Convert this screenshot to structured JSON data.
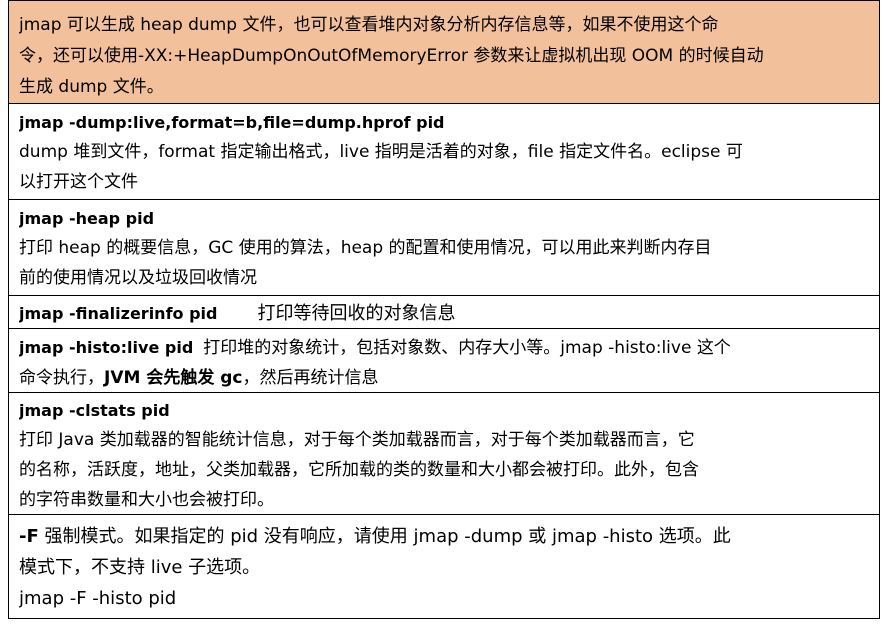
{
  "intro": {
    "line1": "jmap 可以生成 heap dump 文件，也可以查看堆内对象分析内存信息等，如果不使用这个命",
    "line2": "令，还可以使用-XX:+HeapDumpOnOutOfMemoryError 参数来让虚拟机出现 OOM 的时候自动",
    "line3": "生成 dump 文件。",
    "background_color": "#f2c09b"
  },
  "rows": [
    {
      "command": "jmap -dump:live,format=b,file=dump.hprof pid",
      "desc_line1": "dump 堆到文件，format 指定输出格式，live 指明是活着的对象，file 指定文件名。eclipse 可",
      "desc_line2": "以打开这个文件"
    },
    {
      "command": "jmap -heap pid",
      "desc_line1": "打印 heap 的概要信息，GC 使用的算法，heap 的配置和使用情况，可以用此来判断内存目",
      "desc_line2": "前的使用情况以及垃圾回收情况"
    },
    {
      "command": "jmap -finalizerinfo pid",
      "desc_inline": "打印等待回收的对象信息"
    },
    {
      "command": "jmap -histo:live pid",
      "desc_inline": "打印堆的对象统计，包括对象数、内存大小等。jmap -histo:live 这个",
      "desc_line2_pre": "命令执行，",
      "desc_line2_bold": "JVM 会先触发 gc",
      "desc_line2_post": "，然后再统计信息"
    },
    {
      "command": "jmap -clstats pid",
      "desc_line1": "打印 Java 类加载器的智能统计信息，对于每个类加载器而言，对于每个类加载器而言，它",
      "desc_line2": "的名称，活跃度，地址，父类加载器，它所加载的类的数量和大小都会被打印。此外，包含",
      "desc_line3": "的字符串数量和大小也会被打印。"
    },
    {
      "flag": "-F",
      "desc_inline": "强制模式。如果指定的 pid 没有响应，请使用 jmap -dump 或 jmap -histo 选项。此",
      "desc_line2": "模式下，不支持 live 子选项。",
      "example": "jmap -F -histo pid"
    }
  ]
}
